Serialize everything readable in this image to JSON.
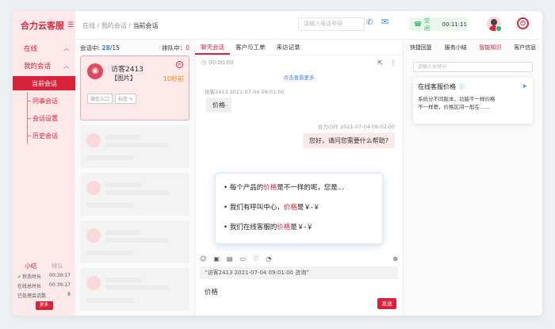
{
  "brand": {
    "title": "合力云客服"
  },
  "sidebar": {
    "online": "在线",
    "my_conversations": "我的会话",
    "current": "当前会话",
    "items": [
      "同事会话",
      "会话设置",
      "历史会话"
    ]
  },
  "summary": {
    "tab_a": "小结",
    "tab_b": "排队",
    "rows": [
      {
        "label": "状态时长",
        "value": "00:39:17"
      },
      {
        "label": "在线总时长",
        "value": "00:39:17"
      },
      {
        "label": "已处理会话数",
        "value": "8"
      }
    ],
    "more": "更多"
  },
  "header": {
    "crumbs": [
      "在线",
      "我的会话",
      "当前会话"
    ],
    "phone_placeholder": "请输入电话号码",
    "status": "空闲",
    "timer": "00:11:11"
  },
  "conversations": {
    "in_session_label": "会话中:",
    "in_session_count": "28",
    "in_session_total": "/15",
    "queue_label": "排队中：",
    "queue_count": "0",
    "active": {
      "name": "访客2413",
      "message": "【图片】",
      "time": "10秒前",
      "tags": [
        "微信入口",
        "标签"
      ]
    }
  },
  "chat": {
    "tabs": [
      "聊天会话",
      "客户与工单",
      "来访记录"
    ],
    "duration": "00:00:00",
    "load_more": "点击查看更多",
    "visitor_meta": "访客2413  2021-07-04 09:01:00",
    "visitor_msg": "价格",
    "agent_meta": "合力小什  2021-07-04 09:02:00",
    "agent_msg": "您好，请问您需要什么帮助?",
    "suggestions": [
      {
        "pre": "每个产品的",
        "kw": "价格",
        "post": "是不一样的呢，您是..."
      },
      {
        "pre": "我们有呼叫中心，",
        "kw": "价格",
        "post": "是￥-￥"
      },
      {
        "pre": "我们在线客服的",
        "kw": "价格",
        "post": "是￥-￥"
      }
    ],
    "quote": "“访客2413 2021-07-04 09:01:00 咨询”",
    "input": "价格",
    "send": "发送"
  },
  "right_panel": {
    "tabs": [
      "快捷回复",
      "服务小结",
      "智能知识",
      "客户信息"
    ],
    "active_tab": 2,
    "search_placeholder": "请输入关键词",
    "card_title": "在线客服价格",
    "card_body": [
      "系统分不同版本，功能不一样价格",
      "不一样嗯，价格区间一般在......"
    ]
  },
  "colors": {
    "accent": "#d9233a",
    "link": "#3b82f6",
    "success": "#2db55d"
  }
}
